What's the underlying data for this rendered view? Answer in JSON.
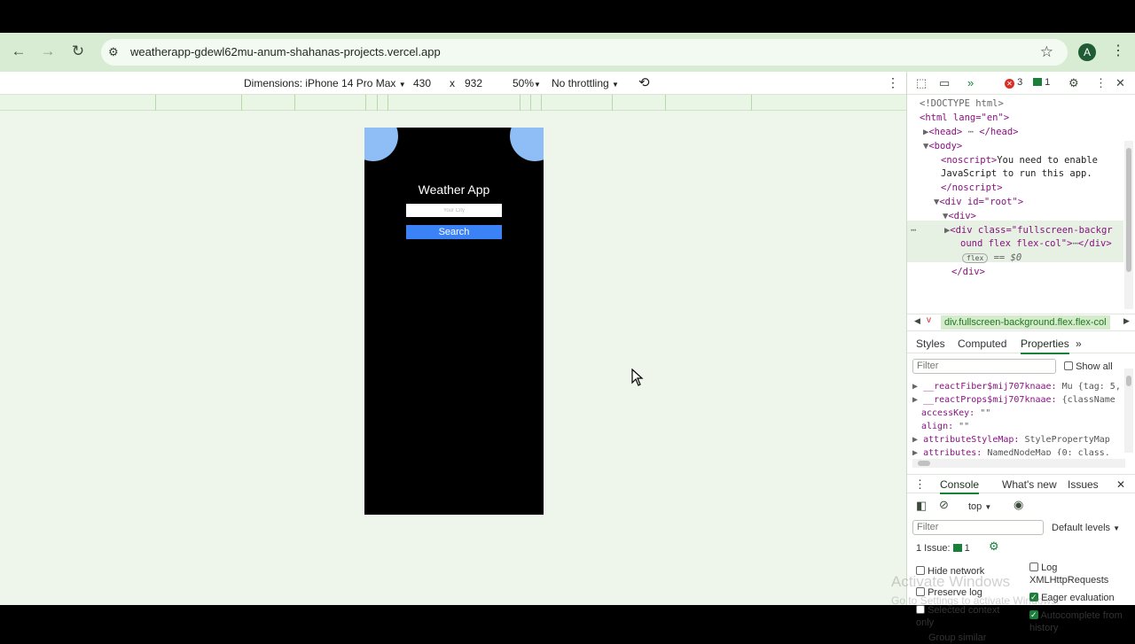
{
  "browser": {
    "url": "weatherapp-gdewl62mu-anum-shahanas-projects.vercel.app",
    "profile_initial": "A"
  },
  "device_toolbar": {
    "dimensions_label": "Dimensions: iPhone 14 Pro Max",
    "width": "430",
    "times": "x",
    "height": "932",
    "zoom": "50%",
    "throttling": "No throttling"
  },
  "app": {
    "title": "Weather App",
    "city_placeholder": "Your City",
    "search_label": "Search",
    "background_color": "#000000",
    "blob_color": "#8fbdf5",
    "button_color": "#3b82f6"
  },
  "devtools": {
    "error_count": "3",
    "message_count": "1",
    "elements": {
      "doctype": "<!DOCTYPE html>",
      "html_open": "<html lang=\"en\">",
      "head": "<head>",
      "head_close": "</head>",
      "body": "<body>",
      "noscript_open": "<noscript>",
      "noscript_text_1": "You need to enable",
      "noscript_text_2": "JavaScript to run this app.",
      "noscript_close": "</noscript>",
      "root_div": "<div id=\"root\">",
      "div_open": "<div>",
      "selected_tag": "<div class=\"fullscreen-backgr",
      "selected_tag_cont": "ound flex flex-col\">",
      "selected_tag_close": "</div>",
      "flex_pill": "flex",
      "eq_dollar": "== $0",
      "div_close": "</div>"
    },
    "breadcrumb": "div.fullscreen-background.flex.flex-col",
    "side_tabs": [
      "Styles",
      "Computed",
      "Properties"
    ],
    "filter_placeholder": "Filter",
    "show_all": "Show all",
    "properties": [
      {
        "key": "__reactFiber$mij707knaae:",
        "val": "Mu {tag: 5,"
      },
      {
        "key": "__reactProps$mij707knaae:",
        "val": "{className"
      },
      {
        "key": "accessKey:",
        "val": "\"\""
      },
      {
        "key": "align:",
        "val": "\"\""
      },
      {
        "key": "attributeStyleMap:",
        "val": "StylePropertyMap"
      },
      {
        "key": "attributes:",
        "val": "NamedNodeMap {0: class,"
      }
    ],
    "console_tabs": [
      "Console",
      "What's new",
      "Issues"
    ],
    "context": "top",
    "default_levels": "Default levels",
    "issues_label": "1 Issue:",
    "issues_count": "1",
    "options": {
      "hide_network": "Hide network",
      "log_xhr": "Log XMLHttpRequests",
      "preserve_log": "Preserve log",
      "eager_eval": "Eager evaluation",
      "selected_context": "Selected context only",
      "autocomplete": "Autocomplete from history",
      "group_similar": "Group similar"
    }
  },
  "watermark": {
    "line1": "Activate Windows",
    "line2": "Go to Settings to activate Windows."
  }
}
